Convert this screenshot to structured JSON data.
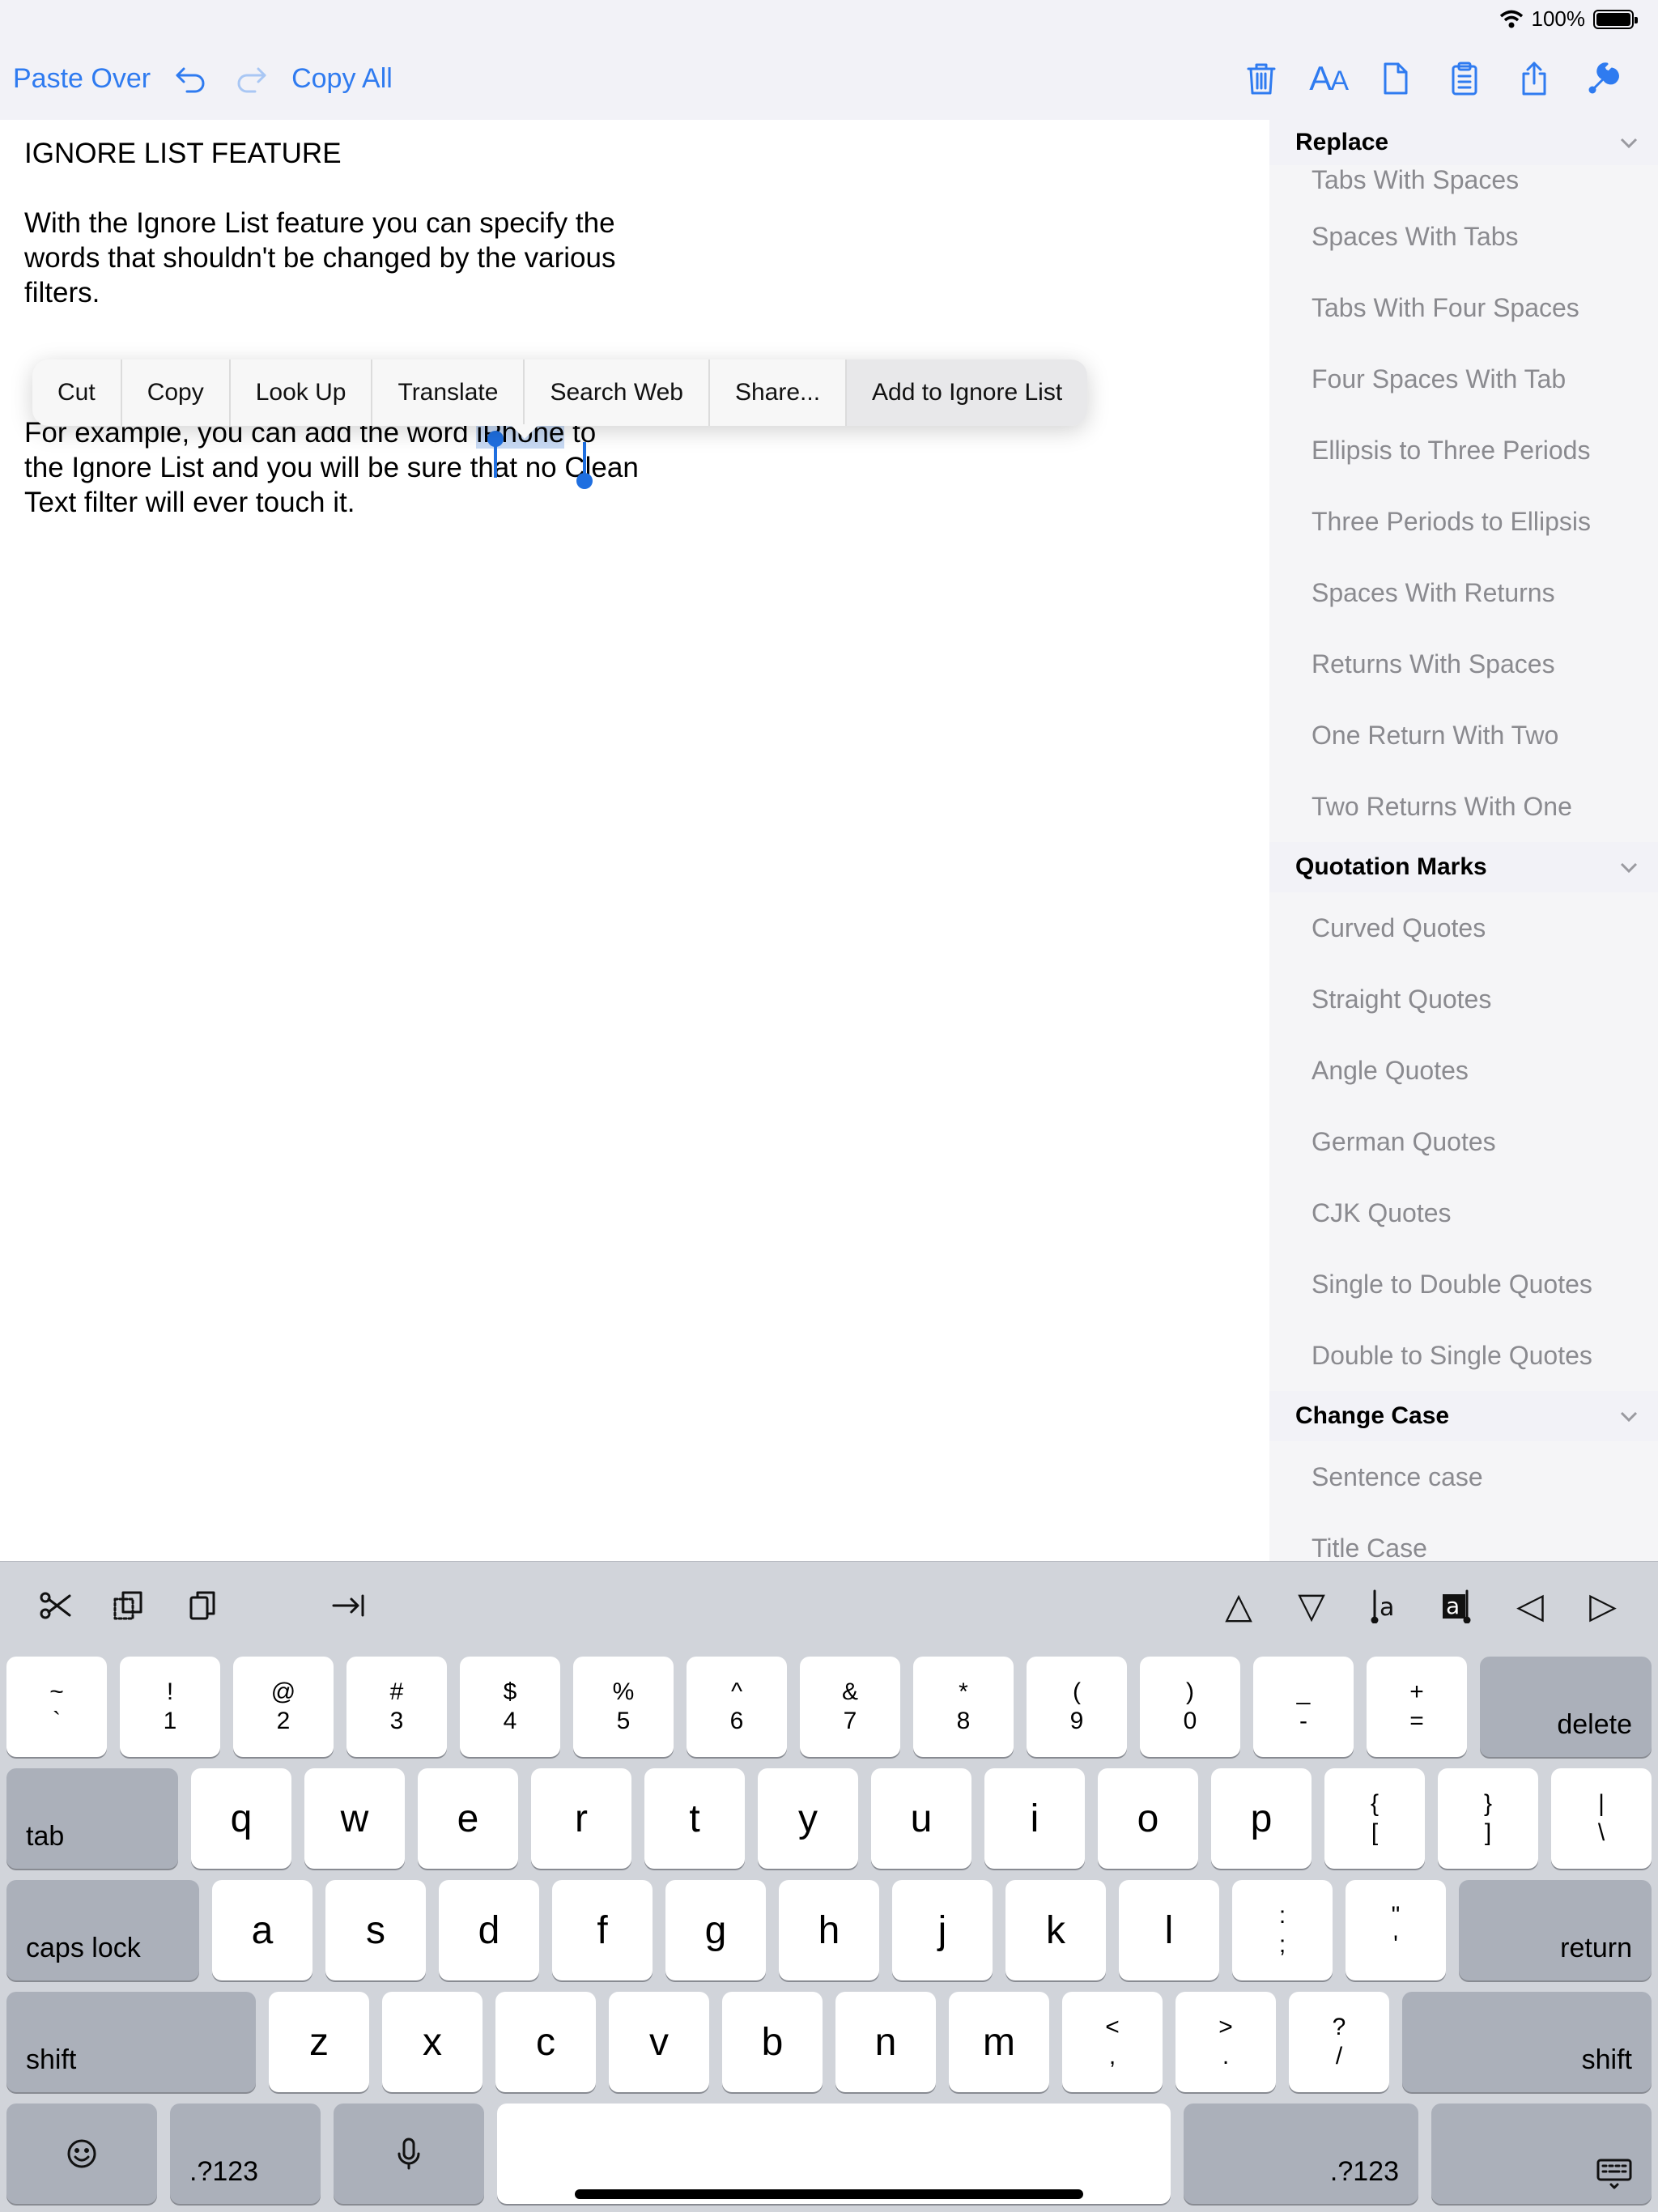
{
  "status": {
    "battery": "100%"
  },
  "toolbar": {
    "paste_over": "Paste Over",
    "copy_all": "Copy All",
    "text_size_label_big": "A",
    "text_size_label_small": "A"
  },
  "editor": {
    "heading": "IGNORE LIST FEATURE",
    "para1": "With the Ignore List feature you can specify the words that shouldn't be changed by the various filters.",
    "para2_before": "For example, you can add the word ",
    "para2_selected": "iPhone",
    "para2_after": " to the Ignore List and you will be sure that no Clean Text filter will ever touch it."
  },
  "context_menu": {
    "items": [
      "Cut",
      "Copy",
      "Look Up",
      "Translate",
      "Search Web",
      "Share...",
      "Add to Ignore List"
    ]
  },
  "sidebar": {
    "sections": [
      {
        "title": "Replace",
        "items": [
          "Tabs With Spaces",
          "Spaces With Tabs",
          "Tabs With Four Spaces",
          "Four Spaces With Tab",
          "Ellipsis to Three Periods",
          "Three Periods to Ellipsis",
          "Spaces With Returns",
          "Returns With Spaces",
          "One Return With Two",
          "Two Returns With One"
        ]
      },
      {
        "title": "Quotation Marks",
        "items": [
          "Curved Quotes",
          "Straight Quotes",
          "Angle Quotes",
          "German Quotes",
          "CJK Quotes",
          "Single to Double Quotes",
          "Double to Single Quotes"
        ]
      },
      {
        "title": "Change Case",
        "items": [
          "Sentence case",
          "Title Case"
        ]
      }
    ]
  },
  "keyboard": {
    "shortcut_glyphs": {
      "up": "△",
      "down": "▽",
      "left": "◁",
      "right": "▷"
    },
    "row1": [
      {
        "top": "~",
        "bottom": "`"
      },
      {
        "top": "!",
        "bottom": "1"
      },
      {
        "top": "@",
        "bottom": "2"
      },
      {
        "top": "#",
        "bottom": "3"
      },
      {
        "top": "$",
        "bottom": "4"
      },
      {
        "top": "%",
        "bottom": "5"
      },
      {
        "top": "^",
        "bottom": "6"
      },
      {
        "top": "&",
        "bottom": "7"
      },
      {
        "top": "*",
        "bottom": "8"
      },
      {
        "top": "(",
        "bottom": "9"
      },
      {
        "top": ")",
        "bottom": "0"
      },
      {
        "top": "_",
        "bottom": "-"
      },
      {
        "top": "+",
        "bottom": "="
      }
    ],
    "delete": "delete",
    "tab": "tab",
    "row2": [
      "q",
      "w",
      "e",
      "r",
      "t",
      "y",
      "u",
      "i",
      "o",
      "p"
    ],
    "row2_sym": [
      {
        "top": "{",
        "bottom": "["
      },
      {
        "top": "}",
        "bottom": "]"
      },
      {
        "top": "|",
        "bottom": "\\"
      }
    ],
    "caps_lock": "caps lock",
    "row3": [
      "a",
      "s",
      "d",
      "f",
      "g",
      "h",
      "j",
      "k",
      "l"
    ],
    "row3_sym": [
      {
        "top": ":",
        "bottom": ";"
      },
      {
        "top": "\"",
        "bottom": "'"
      }
    ],
    "return": "return",
    "shift": "shift",
    "row4": [
      "z",
      "x",
      "c",
      "v",
      "b",
      "n",
      "m"
    ],
    "row4_sym": [
      {
        "top": "<",
        "bottom": ","
      },
      {
        "top": ">",
        "bottom": "."
      },
      {
        "top": "?",
        "bottom": "/"
      }
    ],
    "num_switch": ".?123"
  }
}
